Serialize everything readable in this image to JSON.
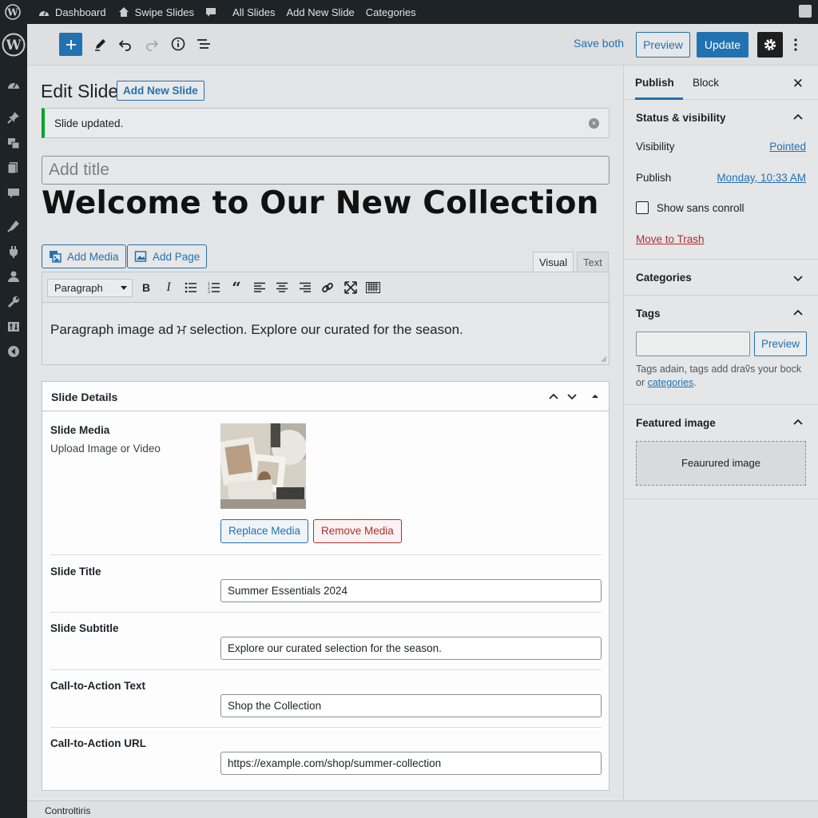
{
  "admin_bar": {
    "dashboard": "Dashboard",
    "site": "Swipe Slides",
    "all_slides": "All Slides",
    "add_new_slide": "Add New Slide",
    "categories": "Categories"
  },
  "header": {
    "save_both": "Save both",
    "preview": "Preview",
    "update": "Update"
  },
  "main": {
    "page_title": "Edit Slide",
    "add_new_button": "Add New Slide",
    "notice": "Slide updated.",
    "title_placeholder": "Add title",
    "post_heading": "Welcome to Our New Collection",
    "add_media": "Add Media",
    "add_page": "Add Page",
    "tab_visual": "Visual",
    "tab_text": "Text",
    "format_select": "Paragraph",
    "content": "Paragraph image ad ਮ selection. Explore our curated for the season."
  },
  "slide_details": {
    "title": "Slide Details",
    "media_label": "Slide Media",
    "media_sub": "Upload Image or Video",
    "replace_media": "Replace Media",
    "remove_media": "Remove Media",
    "slide_title_label": "Slide Title",
    "slide_title_value": "Summer Essentials 2024",
    "slide_subtitle_label": "Slide Subtitle",
    "slide_subtitle_value": "Explore our curated selection for the season.",
    "cta_text_label": "Call-to-Action Text",
    "cta_text_value": "Shop the Collection",
    "cta_url_label": "Call-to-Action URL",
    "cta_url_value": "https://example.com/shop/summer-collection"
  },
  "sidebar": {
    "tab_publish": "Publish",
    "tab_block": "Block",
    "status_title": "Status & visibility",
    "visibility_label": "Visibility",
    "visibility_value": "Pointed",
    "publish_label": "Publish",
    "publish_value": "Monday, 10:33 AM",
    "checkbox_label": "Show sans conroll",
    "move_to_trash": "Move to Trash",
    "categories_title": "Categories",
    "tags_title": "Tags",
    "tags_preview": "Preview",
    "tags_help_prefix": "Tags adain, tags add draṽs your bock or ",
    "tags_help_link": "categories",
    "tags_help_suffix": ".",
    "featured_title": "Featured image",
    "featured_box": "Feaurured image"
  },
  "footer": {
    "text": "Controltiris"
  },
  "colors": {
    "accent": "#2271b1",
    "admin_dark": "#1d2327",
    "success": "#00a32a",
    "danger": "#b32d2e"
  }
}
